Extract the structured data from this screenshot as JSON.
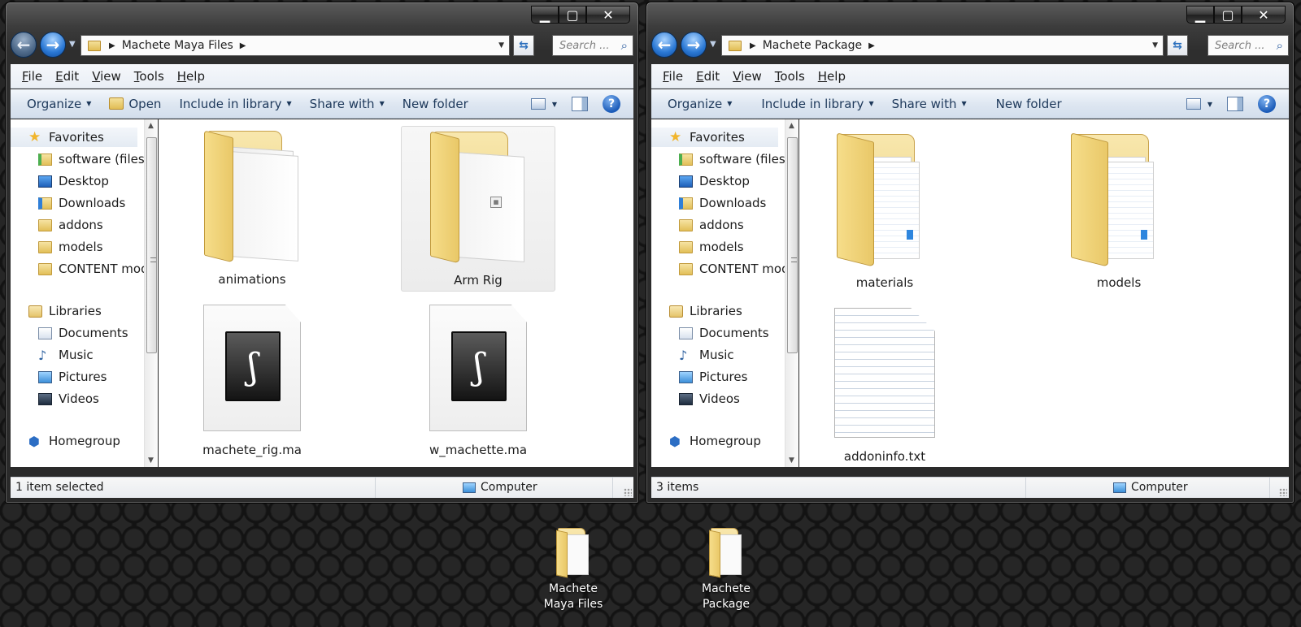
{
  "left_window": {
    "address": {
      "crumb": "Machete Maya Files"
    },
    "search_placeholder": "Search ...",
    "menu": [
      "File",
      "Edit",
      "View",
      "Tools",
      "Help"
    ],
    "commands": {
      "organize": "Organize",
      "open": "Open",
      "include": "Include in library",
      "share": "Share with",
      "new_folder": "New folder"
    },
    "nav": {
      "favorites": "Favorites",
      "fav_items": [
        "software (filese",
        "Desktop",
        "Downloads",
        "addons",
        "models",
        "CONTENT mod"
      ],
      "libraries": "Libraries",
      "lib_items": [
        "Documents",
        "Music",
        "Pictures",
        "Videos"
      ],
      "homegroup": "Homegroup"
    },
    "items": [
      {
        "name": "animations",
        "type": "folder",
        "selected": false
      },
      {
        "name": "Arm Rig",
        "type": "folder",
        "selected": true
      },
      {
        "name": "machete_rig.ma",
        "type": "maya-file",
        "selected": false
      },
      {
        "name": "w_machette.ma",
        "type": "maya-file",
        "selected": false
      }
    ],
    "status": {
      "count": "1 item selected",
      "zone": "Computer"
    }
  },
  "right_window": {
    "address": {
      "crumb": "Machete Package"
    },
    "search_placeholder": "Search ...",
    "menu": [
      "File",
      "Edit",
      "View",
      "Tools",
      "Help"
    ],
    "commands": {
      "organize": "Organize",
      "include": "Include in library",
      "share": "Share with",
      "new_folder": "New folder"
    },
    "nav": {
      "favorites": "Favorites",
      "fav_items": [
        "software (filese",
        "Desktop",
        "Downloads",
        "addons",
        "models",
        "CONTENT mod"
      ],
      "libraries": "Libraries",
      "lib_items": [
        "Documents",
        "Music",
        "Pictures",
        "Videos"
      ],
      "homegroup": "Homegroup"
    },
    "items": [
      {
        "name": "materials",
        "type": "folder"
      },
      {
        "name": "models",
        "type": "folder"
      },
      {
        "name": "addoninfo.txt",
        "type": "text-file"
      }
    ],
    "status": {
      "count": "3 items",
      "zone": "Computer"
    }
  },
  "desktop": {
    "icons": [
      {
        "line1": "Machete",
        "line2": "Maya Files"
      },
      {
        "line1": "Machete",
        "line2": "Package"
      }
    ]
  },
  "colors": {
    "accent": "#1e395b",
    "selection": "#ececec",
    "desktop": "#101010"
  }
}
